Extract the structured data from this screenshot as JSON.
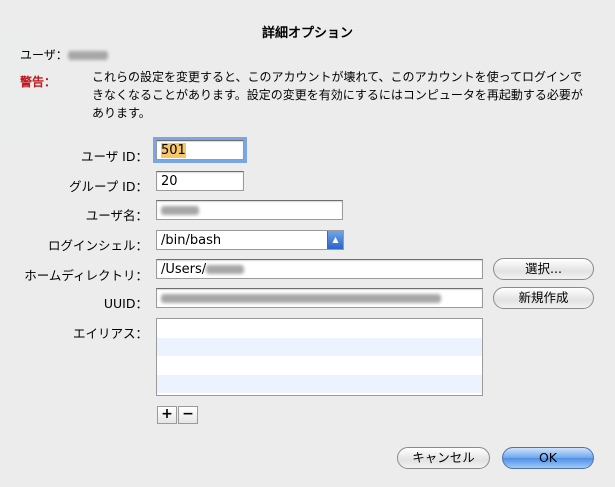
{
  "dialog": {
    "title": "詳細オプション",
    "user_prefix": "ユーザ：",
    "warning_label": "警告：",
    "warning_text": "これらの設定を変更すると、このアカウントが壊れて、このアカウントを使ってログインできなくなることがあります。設定の変更を有効にするにはコンピュータを再起動する必要があります。"
  },
  "fields": {
    "user_id_label": "ユーザ ID：",
    "user_id_value": "501",
    "group_id_label": "グループ ID：",
    "group_id_value": "20",
    "username_label": "ユーザ名：",
    "login_shell_label": "ログインシェル：",
    "login_shell_value": "/bin/bash",
    "home_dir_label": "ホームディレクトリ：",
    "home_dir_value": "/Users/",
    "uuid_label": "UUID：",
    "aliases_label": "エイリアス："
  },
  "buttons": {
    "choose": "選択...",
    "new": "新規作成",
    "add": "+",
    "remove": "−",
    "cancel": "キャンセル",
    "ok": "OK"
  },
  "colors": {
    "warning": "#c0181e",
    "focus_ring": "#7aa7e3",
    "primary_button": "#4f8fe6"
  }
}
